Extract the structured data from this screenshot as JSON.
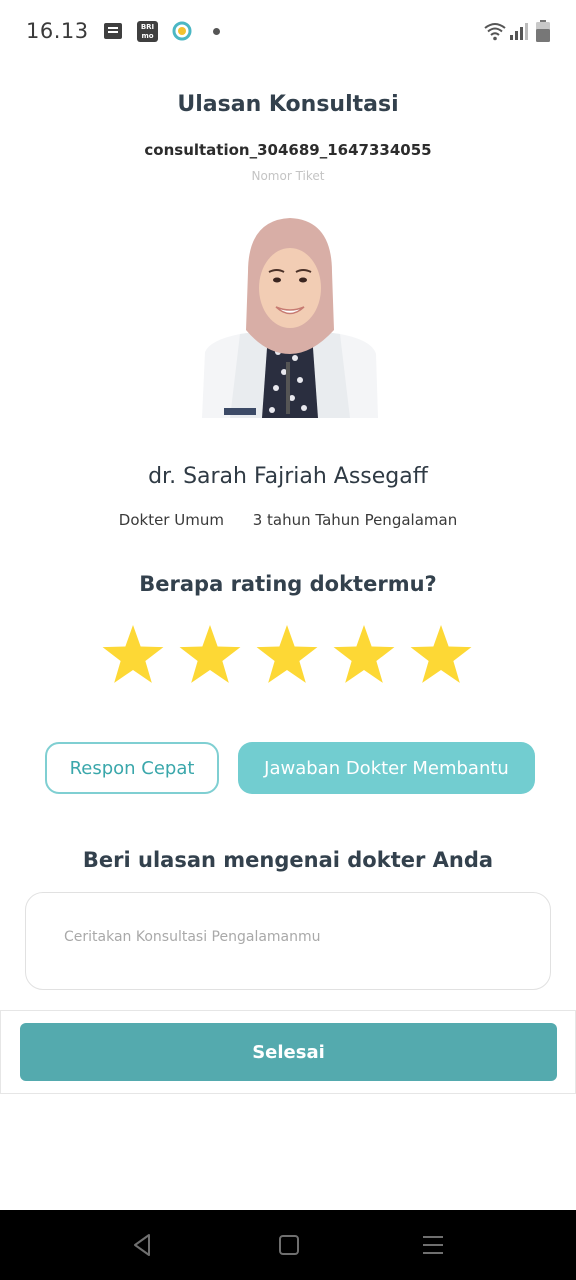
{
  "status_bar": {
    "time": "16.13",
    "brimo_label": "BRI mo",
    "icons": [
      "message-icon",
      "brimo-app-icon",
      "health-app-icon",
      "notification-dot",
      "wifi-icon",
      "signal-icon",
      "battery-icon"
    ]
  },
  "header": {
    "title": "Ulasan Konsultasi",
    "ticket_id": "consultation_304689_1647334055",
    "ticket_label": "Nomor Tiket"
  },
  "doctor": {
    "name": "dr. Sarah Fajriah Assegaff",
    "specialty": "Dokter Umum",
    "experience": "3 tahun Tahun Pengalaman"
  },
  "rating": {
    "question": "Berapa rating doktermu?",
    "value": 5,
    "max": 5,
    "star_color": "#FDD835"
  },
  "tags": [
    {
      "label": "Respon Cepat",
      "selected": false
    },
    {
      "label": "Jawaban Dokter Membantu",
      "selected": true
    }
  ],
  "review": {
    "question": "Beri ulasan mengenai dokter Anda",
    "placeholder": "Ceritakan Konsultasi Pengalamanmu",
    "value": ""
  },
  "submit": {
    "label": "Selesai"
  },
  "colors": {
    "accent": "#54AAAE",
    "tag_selected": "#72CDD0",
    "tag_outline": "#7FCFD2"
  },
  "nav_bar": {
    "buttons": [
      "back-icon",
      "home-icon",
      "menu-icon"
    ]
  }
}
